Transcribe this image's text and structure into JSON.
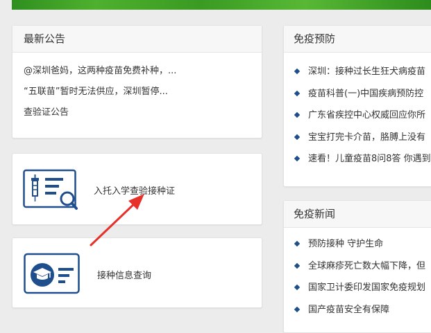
{
  "notice": {
    "title": "最新公告",
    "items": [
      "@深圳爸妈，这两种疫苗免费补种，...",
      "“五联苗”暂时无法供应，深圳暂停...",
      "查验证公告"
    ]
  },
  "services": [
    {
      "label": "入托入学查验接种证",
      "icon": "vaccine-certificate-icon"
    },
    {
      "label": "接种信息查询",
      "icon": "graduation-card-icon"
    }
  ],
  "prevention": {
    "title": "免疫预防",
    "items": [
      "深圳：接种过长生狂犬病疫苗",
      "疫苗科普(一)中国疾病预防控",
      "广东省疾控中心权威回应你所",
      "宝宝打完卡介苗，胳膊上没有",
      "速看！儿童疫苗8问8答 你遇到"
    ]
  },
  "news": {
    "title": "免疫新闻",
    "items": [
      "预防接种 守护生命",
      "全球麻疹死亡数大幅下降，但",
      "国家卫计委印发国家免疫规划",
      "国产疫苗安全有保障"
    ]
  },
  "colors": {
    "accent": "#1f4e8c",
    "arrow": "#e8302a",
    "banner": "#3a9a22"
  }
}
